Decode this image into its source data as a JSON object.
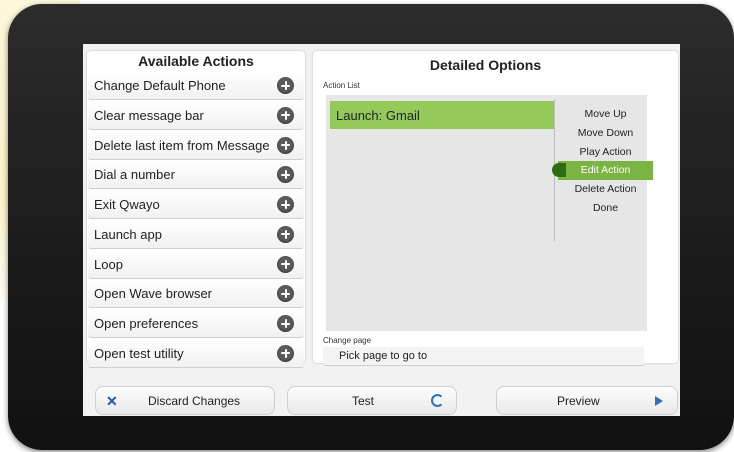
{
  "left_panel": {
    "title": "Available Actions",
    "items": [
      {
        "label": "Change Default Phone"
      },
      {
        "label": "Clear message bar"
      },
      {
        "label": "Delete last item from Message"
      },
      {
        "label": "Dial a number"
      },
      {
        "label": "Exit Qwayo"
      },
      {
        "label": "Launch app"
      },
      {
        "label": "Loop"
      },
      {
        "label": "Open Wave browser"
      },
      {
        "label": "Open preferences"
      },
      {
        "label": "Open test utility"
      }
    ]
  },
  "right_panel": {
    "title": "Detailed Options",
    "action_list_label": "Action List",
    "selected_action": "Launch: Gmail",
    "menu": [
      {
        "label": "Move Up"
      },
      {
        "label": "Move Down"
      },
      {
        "label": "Play Action"
      },
      {
        "label": "Edit Action",
        "active": true
      },
      {
        "label": "Delete Action"
      },
      {
        "label": "Done"
      }
    ],
    "change_page_label": "Change page",
    "change_page_value": "Pick page to go to"
  },
  "bottom_bar": {
    "discard_label": "Discard Changes",
    "test_label": "Test",
    "preview_label": "Preview"
  },
  "colors": {
    "accent_green": "#95c95a",
    "active_green": "#7ab442",
    "icon_blue": "#2a73c2"
  },
  "icons": {
    "add": "plus-circle-icon",
    "discard": "close-icon",
    "test": "refresh-icon",
    "preview": "play-icon"
  }
}
